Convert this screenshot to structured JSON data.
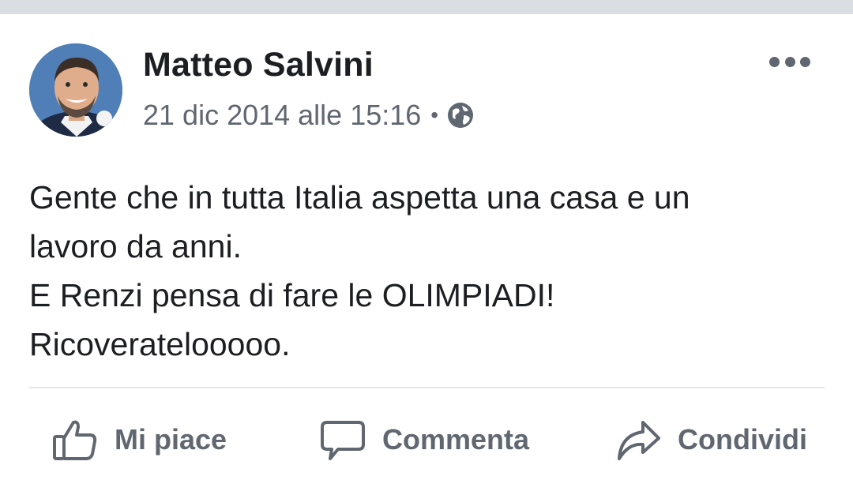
{
  "post": {
    "author": "Matteo Salvini",
    "timestamp": "21 dic 2014 alle 15:16",
    "separator": "•",
    "privacy_icon": "globe-icon",
    "more_icon": "more-options-icon",
    "text_lines": [
      "Gente che in tutta Italia aspetta una casa e un",
      "lavoro da anni.",
      "E Renzi pensa di fare le OLIMPIADI!",
      "Ricoveratelooooo."
    ]
  },
  "actions": {
    "like": {
      "label": "Mi piace",
      "icon": "thumbs-up-icon"
    },
    "comment": {
      "label": "Commenta",
      "icon": "comment-bubble-icon"
    },
    "share": {
      "label": "Condividi",
      "icon": "share-arrow-icon"
    }
  },
  "colors": {
    "text_primary": "#1c1e21",
    "text_secondary": "#606770",
    "divider": "#e4e6eb",
    "top_bar": "#dadde1"
  }
}
